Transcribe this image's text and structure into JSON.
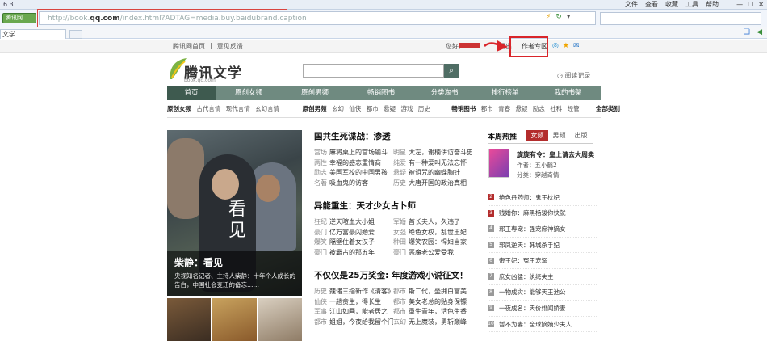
{
  "browser": {
    "title": "6.3",
    "menu": [
      "文件",
      "查看",
      "收藏",
      "工具",
      "帮助"
    ],
    "mode_button": "腾讯网",
    "url_prefix": "http://book.",
    "url_domain": "qq.com",
    "url_rest": "/index.html?ADTAG=media.buy.baidubrand.caption",
    "tab_label": "文学"
  },
  "site_top": {
    "links": [
      "腾讯网首页",
      "意见反馈"
    ],
    "hello": "您好,",
    "logout": "退出",
    "author_zone": "作者专区"
  },
  "header": {
    "logo_text": "腾讯文学",
    "logo_sub": "book.qq.com",
    "history_label": "阅读记录"
  },
  "main_nav": [
    "首页",
    "原创女频",
    "原创男频",
    "畅销图书",
    "分类淘书",
    "排行榜单",
    "我的书架"
  ],
  "sub_nav": {
    "female_label": "原创女频",
    "female_items": [
      "古代言情",
      "现代言情",
      "玄幻言情"
    ],
    "male_label": "原创男频",
    "male_items": [
      "玄幻",
      "仙侠",
      "都市",
      "悬疑",
      "游戏",
      "历史"
    ],
    "best_label": "畅销图书",
    "best_items": [
      "都市",
      "青春",
      "悬疑",
      "励志",
      "社科",
      "经管"
    ],
    "all_label": "全部类别"
  },
  "feature": {
    "overlay_text": "看见",
    "caption_title": "柴静：看见",
    "caption_desc": "央视知名记者、主持人柴静：十年个人成长的告白，中国社会变迁的备忘……"
  },
  "center": {
    "sections": [
      {
        "title": "国共生死谍战：渗透",
        "rows": [
          [
            [
              "宫场",
              "麻将桌上的宫场输斗"
            ],
            [
              "明星",
              "大左，谢楠讲访奋斗史"
            ]
          ],
          [
            [
              "两性",
              "幸福的感恋重情商"
            ],
            [
              "纯爱",
              "有一种爱叫无法忘怀"
            ]
          ],
          [
            [
              "励志",
              "美国军校的中国男孩"
            ],
            [
              "悬疑",
              "被诅咒的幽蝶胸针"
            ]
          ],
          [
            [
              "名著",
              "吸血鬼的访客"
            ],
            [
              "历史",
              "大唐开国的政治真相"
            ]
          ]
        ]
      },
      {
        "title": "异能重生：天才少女占卜师",
        "rows": [
          [
            [
              "狂纪",
              "逆天暄血大小姐"
            ],
            [
              "军婚",
              "首长夫人，久违了"
            ]
          ],
          [
            [
              "豪门",
              "亿万富豪闪婚爱"
            ],
            [
              "女强",
              "绝色女权，乱世王妃"
            ]
          ],
          [
            [
              "爆笑",
              "隔壁住着女汉子"
            ],
            [
              "种田",
              "爆笑农园：悍妇当家"
            ]
          ],
          [
            [
              "豪门",
              "被霸占的那五年"
            ],
            [
              "豪门",
              "恶魔老公爱受我"
            ]
          ]
        ]
      },
      {
        "title": "不仅仅是25万奖金: 年度游戏小说征文！",
        "rows": [
          [
            [
              "历史",
              "魏诸三指新作《清客》"
            ],
            [
              "都市",
              "斯二代，坐拥白富美"
            ]
          ],
          [
            [
              "仙侠",
              "一趟贪生，得长生"
            ],
            [
              "都市",
              "美女老总的贴身保镖"
            ]
          ],
          [
            [
              "军事",
              "江山如画，能者居之"
            ],
            [
              "都市",
              "重生青年，活色生香"
            ]
          ],
          [
            [
              "都市",
              "姐姐，今夜给我留个门"
            ],
            [
              "玄幻",
              "无上魔装，勇斩巅峰"
            ]
          ]
        ]
      }
    ]
  },
  "hot": {
    "title": "本周热推",
    "tabs": [
      "女频",
      "男频",
      "出版"
    ],
    "feature_book": {
      "title": "旋旋有令：皇上请去大周卖",
      "author": "作者：五小鹤2",
      "genre": "分类：穿越奇情"
    },
    "ranks": [
      {
        "num": "2",
        "title": "绝色丹药师：鬼王枕妃"
      },
      {
        "num": "3",
        "title": "贱婚你：麻黑杨骏你快就"
      },
      {
        "num": "4",
        "title": "邪王專宠：强宠庶神嫡女"
      },
      {
        "num": "5",
        "title": "邪凤逆天：韩城杀手妃"
      },
      {
        "num": "6",
        "title": "帝王妃：冤王宠溺"
      },
      {
        "num": "7",
        "title": "庶女凶猛：纨绔夫主"
      },
      {
        "num": "8",
        "title": "一物成灾：能够天王池公"
      },
      {
        "num": "9",
        "title": "一夜成名：天价绯闻娇妻"
      },
      {
        "num": "10",
        "title": "暂不为妻：全球嫡嫡少夫人"
      }
    ]
  }
}
